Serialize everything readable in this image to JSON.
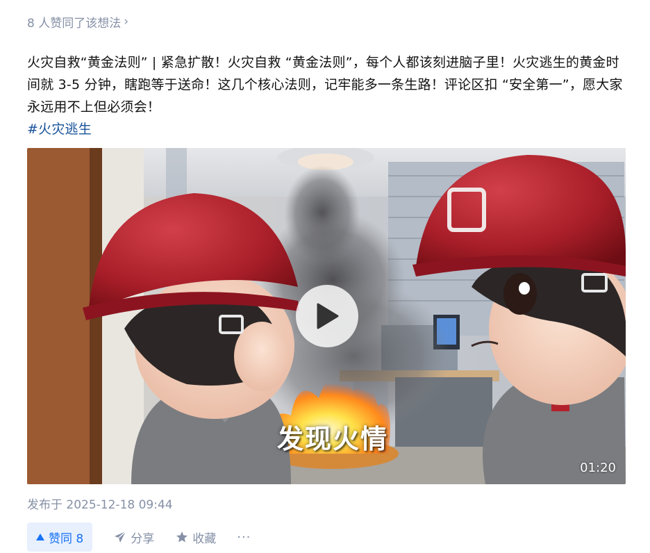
{
  "likers": {
    "text": "8 人赞同了该想法",
    "chevron": "›"
  },
  "post": {
    "content": "火灾自救“黄金法则” | 紧急扩散！火灾自救 “黄金法则”，每个人都该刻进脑子里！火灾逃生的黄金时间就 3-5 分钟，瞎跑等于送命！这几个核心法则，记牢能多一条生路！评论区扣 “安全第一”，愿大家永远用不上但必须会！",
    "hashtag": "#火灾逃生"
  },
  "video": {
    "caption": "发现火情",
    "duration": "01:20",
    "icons": [
      "play-icon"
    ]
  },
  "meta": {
    "published": "发布于 2025-12-18 09:44"
  },
  "actions": {
    "vote_label": "赞同 8",
    "share_label": "分享",
    "collect_label": "收藏",
    "more_label": "···"
  },
  "colors": {
    "link": "#175199",
    "vote_bg": "#e8f0fe",
    "vote_text": "#1772f6",
    "meta_text": "#8590a6",
    "body_text": "#121212"
  }
}
